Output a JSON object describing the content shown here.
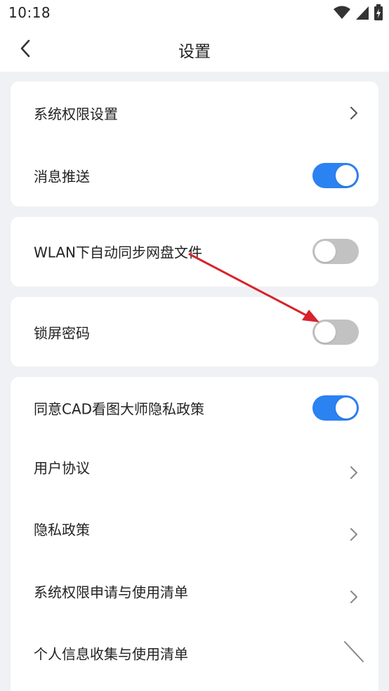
{
  "status_bar": {
    "time": "10:18",
    "icons": [
      "wifi-icon",
      "cell-signal-icon",
      "battery-charging-icon"
    ]
  },
  "header": {
    "title": "设置",
    "back_icon": "chevron-left-icon"
  },
  "card1": {
    "system_permission_label": "系统权限设置",
    "push_label": "消息推送",
    "push_enabled": true
  },
  "card2": {
    "wlan_sync_label": "WLAN下自动同步网盘文件",
    "wlan_sync_enabled": false
  },
  "card3": {
    "lock_label": "锁屏密码",
    "lock_enabled": false
  },
  "card4": {
    "privacy_agree_label": "同意CAD看图大师隐私政策",
    "privacy_agree_enabled": true,
    "user_agreement_label": "用户协议",
    "privacy_policy_label": "隐私政策",
    "permission_list_label": "系统权限申请与使用清单",
    "personal_info_label": "个人信息收集与使用清单"
  },
  "colors": {
    "accent": "#2b82f1",
    "toggle_off": "#c2c2c2",
    "annotation_arrow": "#d8232a",
    "background": "#f0f1f5"
  }
}
